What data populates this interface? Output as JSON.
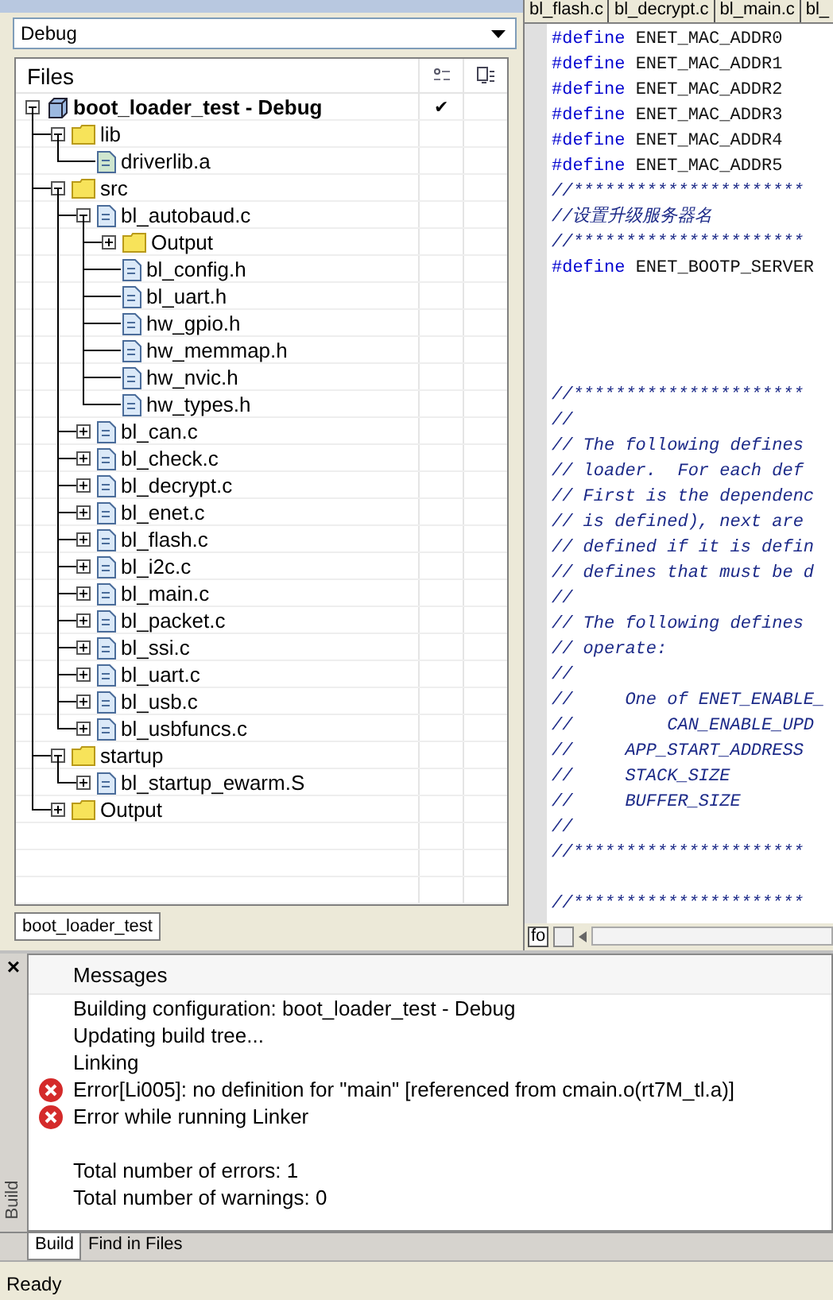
{
  "workspace": {
    "configuration": "Debug"
  },
  "files_panel": {
    "header": "Files",
    "tree": [
      {
        "name": "boot_loader_test - Debug",
        "kind": "project",
        "expanded": true,
        "check": "✔",
        "children": [
          {
            "name": "lib",
            "kind": "folder",
            "expanded": true,
            "children": [
              {
                "name": "driverlib.a",
                "kind": "library"
              }
            ]
          },
          {
            "name": "src",
            "kind": "folder",
            "expanded": true,
            "children": [
              {
                "name": "bl_autobaud.c",
                "kind": "source",
                "expanded": true,
                "children": [
                  {
                    "name": "Output",
                    "kind": "folder",
                    "expanded": false
                  },
                  {
                    "name": "bl_config.h",
                    "kind": "header"
                  },
                  {
                    "name": "bl_uart.h",
                    "kind": "header"
                  },
                  {
                    "name": "hw_gpio.h",
                    "kind": "header"
                  },
                  {
                    "name": "hw_memmap.h",
                    "kind": "header"
                  },
                  {
                    "name": "hw_nvic.h",
                    "kind": "header"
                  },
                  {
                    "name": "hw_types.h",
                    "kind": "header"
                  }
                ]
              },
              {
                "name": "bl_can.c",
                "kind": "source",
                "expanded": false
              },
              {
                "name": "bl_check.c",
                "kind": "source",
                "expanded": false
              },
              {
                "name": "bl_decrypt.c",
                "kind": "source",
                "expanded": false
              },
              {
                "name": "bl_enet.c",
                "kind": "source",
                "expanded": false
              },
              {
                "name": "bl_flash.c",
                "kind": "source",
                "expanded": false
              },
              {
                "name": "bl_i2c.c",
                "kind": "source",
                "expanded": false
              },
              {
                "name": "bl_main.c",
                "kind": "source",
                "expanded": false
              },
              {
                "name": "bl_packet.c",
                "kind": "source",
                "expanded": false
              },
              {
                "name": "bl_ssi.c",
                "kind": "source",
                "expanded": false
              },
              {
                "name": "bl_uart.c",
                "kind": "source",
                "expanded": false
              },
              {
                "name": "bl_usb.c",
                "kind": "source",
                "expanded": false
              },
              {
                "name": "bl_usbfuncs.c",
                "kind": "source",
                "expanded": false
              }
            ]
          },
          {
            "name": "startup",
            "kind": "folder",
            "expanded": true,
            "children": [
              {
                "name": "bl_startup_ewarm.S",
                "kind": "assembly",
                "expanded": false
              }
            ]
          },
          {
            "name": "Output",
            "kind": "folder",
            "expanded": false
          }
        ]
      }
    ],
    "tab": "boot_loader_test"
  },
  "editor": {
    "tabs": [
      "bl_flash.c",
      "bl_decrypt.c",
      "bl_main.c",
      "bl_"
    ],
    "lines": [
      {
        "kind": "directive",
        "keyword": "#define",
        "text": "ENET_MAC_ADDR0"
      },
      {
        "kind": "directive",
        "keyword": "#define",
        "text": "ENET_MAC_ADDR1"
      },
      {
        "kind": "directive",
        "keyword": "#define",
        "text": "ENET_MAC_ADDR2"
      },
      {
        "kind": "directive",
        "keyword": "#define",
        "text": "ENET_MAC_ADDR3"
      },
      {
        "kind": "directive",
        "keyword": "#define",
        "text": "ENET_MAC_ADDR4"
      },
      {
        "kind": "directive",
        "keyword": "#define",
        "text": "ENET_MAC_ADDR5"
      },
      {
        "kind": "comment",
        "text": "//**********************"
      },
      {
        "kind": "comment",
        "text": "//设置升级服务器名"
      },
      {
        "kind": "comment",
        "text": "//**********************"
      },
      {
        "kind": "directive",
        "keyword": "#define",
        "text": "ENET_BOOTP_SERVER"
      },
      {
        "kind": "blank"
      },
      {
        "kind": "blank"
      },
      {
        "kind": "blank"
      },
      {
        "kind": "blank"
      },
      {
        "kind": "comment",
        "text": "//**********************"
      },
      {
        "kind": "comment",
        "text": "//"
      },
      {
        "kind": "comment",
        "text": "// The following defines"
      },
      {
        "kind": "comment",
        "text": "// loader.  For each def"
      },
      {
        "kind": "comment",
        "text": "// First is the dependenc"
      },
      {
        "kind": "comment",
        "text": "// is defined), next are"
      },
      {
        "kind": "comment",
        "text": "// defined if it is defin"
      },
      {
        "kind": "comment",
        "text": "// defines that must be d"
      },
      {
        "kind": "comment",
        "text": "//"
      },
      {
        "kind": "comment",
        "text": "// The following defines"
      },
      {
        "kind": "comment",
        "text": "// operate:"
      },
      {
        "kind": "comment",
        "text": "//"
      },
      {
        "kind": "comment",
        "text": "//     One of ENET_ENABLE_"
      },
      {
        "kind": "comment",
        "text": "//         CAN_ENABLE_UPD"
      },
      {
        "kind": "comment",
        "text": "//     APP_START_ADDRESS"
      },
      {
        "kind": "comment",
        "text": "//     STACK_SIZE"
      },
      {
        "kind": "comment",
        "text": "//     BUFFER_SIZE"
      },
      {
        "kind": "comment",
        "text": "//"
      },
      {
        "kind": "comment",
        "text": "//**********************"
      },
      {
        "kind": "blank"
      },
      {
        "kind": "comment",
        "text": "//**********************"
      }
    ],
    "scrollbar_button": "fo"
  },
  "build": {
    "close": "×",
    "panel_label": "Build",
    "header": "Messages",
    "messages": [
      {
        "kind": "info",
        "text": "Building configuration: boot_loader_test - Debug"
      },
      {
        "kind": "info",
        "text": "Updating build tree..."
      },
      {
        "kind": "info",
        "text": "Linking"
      },
      {
        "kind": "error",
        "text": "Error[Li005]: no definition for \"main\" [referenced from cmain.o(rt7M_tl.a)]"
      },
      {
        "kind": "error",
        "text": "Error while running Linker"
      }
    ],
    "summary": [
      "Total number of errors: 1",
      "Total number of warnings: 0"
    ],
    "tabs": [
      {
        "label": "Build",
        "selected": true
      },
      {
        "label": "Find in Files",
        "selected": false
      }
    ]
  },
  "status_bar": {
    "text": "Ready"
  }
}
